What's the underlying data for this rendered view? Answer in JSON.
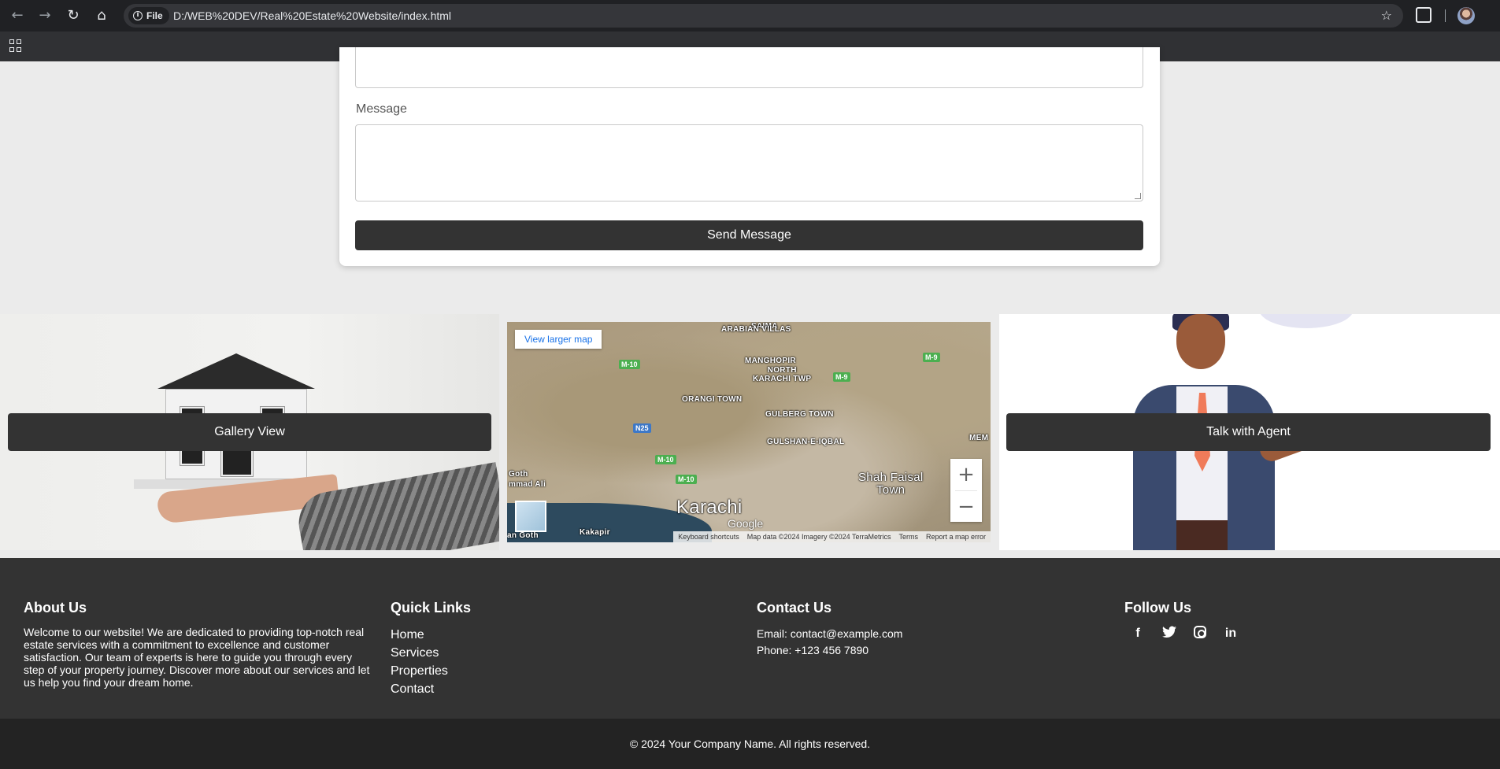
{
  "browser": {
    "file_chip_label": "File",
    "url": "D:/WEB%20DEV/Real%20Estate%20Website/index.html"
  },
  "form": {
    "message_label": "Message",
    "send_button": "Send Message"
  },
  "features": {
    "gallery_button": "Gallery View",
    "agent_button": "Talk with Agent",
    "map": {
      "view_larger": "View larger map",
      "labels": {
        "saima": "SAIMA",
        "arabian_villas": "ARABIAN VILLAS",
        "manghopir": "MANGHOPIR",
        "north_karachi": "NORTH\nKARACHI TWP",
        "orangi": "ORANGI TOWN",
        "gulberg": "GULBERG TOWN",
        "gulshan": "GULSHAN-E-IQBAL",
        "shah_faisal": "Shah Faisal",
        "town": "Town",
        "karachi": "Karachi",
        "goth": "Goth",
        "mmad_ali": "mmad Ali",
        "kakapir": "Kakapir",
        "mem": "MEM",
        "gothn": "an Goth"
      },
      "roads": {
        "m10a": "M-10",
        "m9a": "M-9",
        "m9b": "M-9",
        "n25": "N25",
        "m10b": "M-10",
        "m10c": "M-10"
      },
      "zoom_in": "+",
      "zoom_out": "−",
      "google": "Google",
      "attribution": {
        "keyboard": "Keyboard shortcuts",
        "mapdata": "Map data ©2024 Imagery ©2024 TerraMetrics",
        "terms": "Terms",
        "report": "Report a map error"
      }
    }
  },
  "footer": {
    "about": {
      "title": "About Us",
      "text": "Welcome to our website! We are dedicated to providing top-notch real estate services with a commitment to excellence and customer satisfaction. Our team of experts is here to guide you through every step of your property journey. Discover more about our services and let us help you find your dream home."
    },
    "links": {
      "title": "Quick Links",
      "items": [
        "Home",
        "Services",
        "Properties",
        "Contact"
      ]
    },
    "contact": {
      "title": "Contact Us",
      "email": "Email: contact@example.com",
      "phone": "Phone: +123 456 7890"
    },
    "follow": {
      "title": "Follow Us",
      "icons": {
        "facebook": "f",
        "twitter": "🐦",
        "linkedin": "in"
      }
    },
    "copyright": "© 2024 Your Company Name. All rights reserved."
  }
}
